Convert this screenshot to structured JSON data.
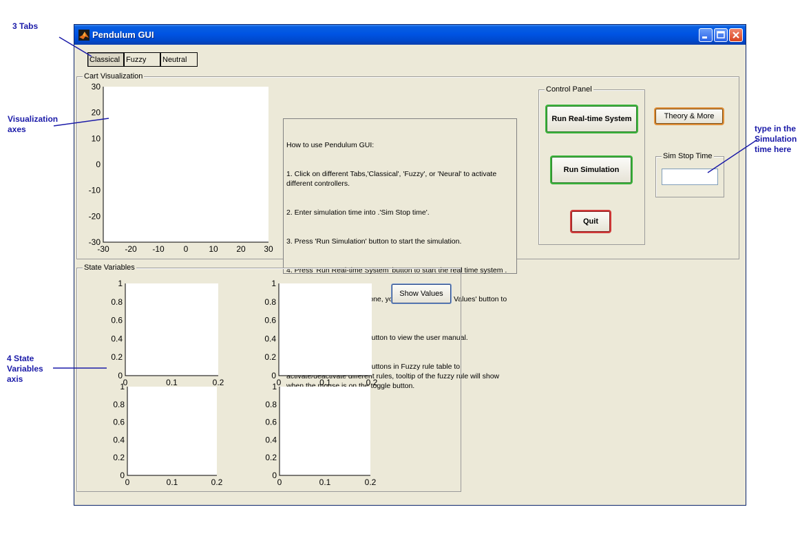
{
  "annotations": {
    "tabs": "3 Tabs",
    "visualization": "Visualization axes",
    "sim_time": "type in the Simulation time here",
    "state_vars": "4 State Variables axis"
  },
  "window": {
    "title": "Pendulum GUI",
    "controls": [
      "minimize-icon",
      "maximize-icon",
      "close-icon"
    ]
  },
  "tabs": [
    {
      "label": "Classical",
      "active": true
    },
    {
      "label": "Fuzzy",
      "active": false
    },
    {
      "label": "Neutral",
      "active": false
    }
  ],
  "cart_panel": {
    "title": "Cart Visualization",
    "axes": {
      "xticks": [
        "-30",
        "-20",
        "-10",
        "0",
        "10",
        "20",
        "30"
      ],
      "yticks": [
        "30",
        "20",
        "10",
        "0",
        "-10",
        "-20",
        "-30"
      ],
      "xlim": [
        -30,
        30
      ],
      "ylim": [
        -30,
        30
      ]
    }
  },
  "instructions": {
    "heading": "How to use Pendulum GUI:",
    "lines": [
      "1. Click on different Tabs,'Classical', 'Fuzzy', or 'Neural' to activate different controllers.",
      "2. Enter simulation time into .'Sim Stop time'.",
      "3. Press 'Run Simulation' button to start the simulation.",
      "4. Press 'Run Real-time System' button to start the real time system .",
      "5. After the simulation is done, you can press 'Show Values' button to plot the state variables.",
      "6. Press 'Theory & More' button to view the user manual.",
      "7. In Fuzzy mode, toggle buttons in Fuzzy rule table to activate/deactivate different rules, tooltip of the fuzzy rule will show when the mouse is on the toggle button."
    ]
  },
  "control_panel": {
    "title": "Control Panel",
    "run_realtime": "Run Real-time System",
    "run_simulation": "Run Simulation",
    "quit": "Quit"
  },
  "theory_button": "Theory & More",
  "sim_stop": {
    "title": "Sim Stop Time",
    "value": ""
  },
  "state_panel": {
    "title": "State Variables",
    "show_values": "Show Values",
    "axes": {
      "xticks": [
        "0",
        "0.1",
        "0.2"
      ],
      "yticks": [
        "1",
        "0.8",
        "0.6",
        "0.4",
        "0.2",
        "0"
      ],
      "xlim": [
        0,
        0.2
      ],
      "ylim": [
        0,
        1
      ]
    }
  },
  "colors": {
    "titlebar": "#0054e3",
    "window_bg": "#ece9d8",
    "annotation": "#1a1aa8"
  }
}
